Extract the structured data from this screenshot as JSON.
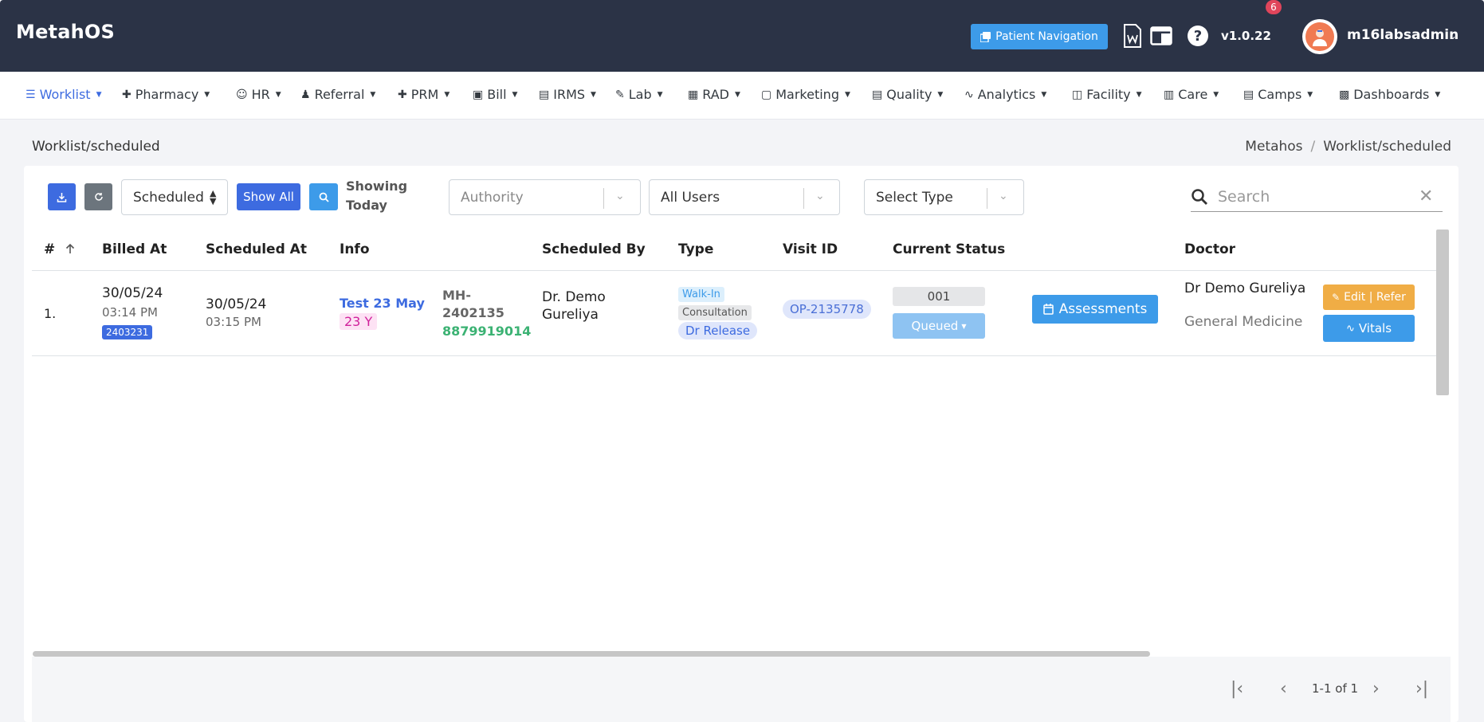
{
  "app": {
    "title": "MetahOS",
    "patient_nav_label": "Patient Navigation",
    "version": "v1.0.22",
    "notification_count": "6",
    "username": "m16labsadmin"
  },
  "nav": {
    "items": [
      {
        "label": "Worklist",
        "icon": "list-icon"
      },
      {
        "label": "Pharmacy",
        "icon": "plus-icon"
      },
      {
        "label": "HR",
        "icon": "user-circle-icon"
      },
      {
        "label": "Referral",
        "icon": "users-icon"
      },
      {
        "label": "PRM",
        "icon": "plus-icon"
      },
      {
        "label": "Bill",
        "icon": "bill-icon"
      },
      {
        "label": "IRMS",
        "icon": "id-card-icon"
      },
      {
        "label": "Lab",
        "icon": "pen-icon"
      },
      {
        "label": "RAD",
        "icon": "film-icon"
      },
      {
        "label": "Marketing",
        "icon": "bag-icon"
      },
      {
        "label": "Quality",
        "icon": "card-icon"
      },
      {
        "label": "Analytics",
        "icon": "pulse-icon"
      },
      {
        "label": "Facility",
        "icon": "building-icon"
      },
      {
        "label": "Care",
        "icon": "bed-icon"
      },
      {
        "label": "Camps",
        "icon": "briefcase-icon"
      },
      {
        "label": "Dashboards",
        "icon": "grid-icon"
      }
    ]
  },
  "page": {
    "title": "Worklist/scheduled",
    "breadcrumb": [
      "Metahos",
      "Worklist/scheduled"
    ]
  },
  "toolbar": {
    "filter_value": "Scheduled",
    "show_all_label": "Show All",
    "showing_line1": "Showing",
    "showing_line2": "Today",
    "authority_placeholder": "Authority",
    "users_value": "All Users",
    "type_value": "Select Type",
    "search_placeholder": "Search"
  },
  "table": {
    "columns": [
      "#",
      "Billed At",
      "Scheduled At",
      "Info",
      "Scheduled By",
      "Type",
      "Visit ID",
      "Current Status",
      "Doctor"
    ],
    "rows": [
      {
        "index": "1.",
        "billed_date": "30/05/24",
        "billed_time": "03:14 PM",
        "billed_badge": "2403231",
        "scheduled_date": "30/05/24",
        "scheduled_time": "03:15 PM",
        "patient_name": "Test 23 May",
        "patient_age": "23 Y",
        "mrn_line1": "MH-",
        "mrn_line2": "2402135",
        "phone": "8879919014",
        "scheduled_by_line1": "Dr. Demo",
        "scheduled_by_line2": "Gureliya",
        "type_walkin": "Walk-In",
        "type_consult": "Consultation",
        "type_release": "Dr Release",
        "visit_id": "OP-2135778",
        "status_code": "001",
        "status_label": "Queued",
        "assessments_label": "Assessments",
        "doctor_name": "Dr Demo Gureliya",
        "doctor_dept": "General Medicine",
        "edit_label": "Edit | Refer",
        "vitals_label": "Vitals"
      }
    ]
  },
  "pagination": {
    "text": "1-1 of 1"
  },
  "colors": {
    "header_bg": "#2b3346",
    "primary": "#3d6be0",
    "info": "#3d9be9",
    "warning": "#f0ad45",
    "secondary": "#6c757d"
  }
}
